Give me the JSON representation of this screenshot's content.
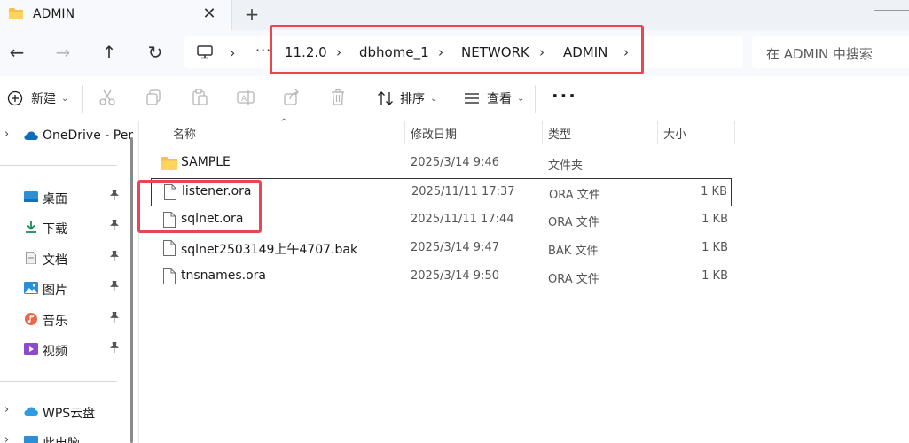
{
  "window": {
    "tab_title": "ADMIN",
    "new_tab": "+",
    "close": "✕"
  },
  "nav": {
    "back": "←",
    "forward": "→",
    "up": "↑",
    "refresh": "↻"
  },
  "address": {
    "more": "···",
    "chevron": "›",
    "crumbs": [
      "11.2.0",
      "dbhome_1",
      "NETWORK",
      "ADMIN"
    ],
    "separator": "›"
  },
  "search": {
    "placeholder": "在 ADMIN 中搜索"
  },
  "toolbar": {
    "new_label": "新建",
    "sort_label": "排序",
    "view_label": "查看",
    "more": "···",
    "dropdown": "⌄"
  },
  "sidebar": {
    "items": [
      {
        "label": "OneDrive - Per",
        "icon": "cloud-icon"
      },
      {
        "label": "桌面",
        "icon": "desktop-icon",
        "pinned": true
      },
      {
        "label": "下载",
        "icon": "download-icon",
        "pinned": true
      },
      {
        "label": "文档",
        "icon": "document-icon",
        "pinned": true
      },
      {
        "label": "图片",
        "icon": "pictures-icon",
        "pinned": true
      },
      {
        "label": "音乐",
        "icon": "music-icon",
        "pinned": true
      },
      {
        "label": "视频",
        "icon": "video-icon",
        "pinned": true
      },
      {
        "label": "WPS云盘",
        "icon": "wps-cloud-icon"
      },
      {
        "label": "此电脑",
        "icon": "computer-icon"
      }
    ],
    "expander": "›",
    "pin": "📌"
  },
  "columns": {
    "name": "名称",
    "modified": "修改日期",
    "type": "类型",
    "size": "大小",
    "sort_arrow": "^"
  },
  "files": [
    {
      "name": "SAMPLE",
      "modified": "2025/3/14 9:46",
      "type": "文件夹",
      "size": "",
      "kind": "folder"
    },
    {
      "name": "listener.ora",
      "modified": "2025/11/11 17:37",
      "type": "ORA 文件",
      "size": "1 KB",
      "kind": "file",
      "selected": true
    },
    {
      "name": "sqlnet.ora",
      "modified": "2025/11/11 17:44",
      "type": "ORA 文件",
      "size": "1 KB",
      "kind": "file"
    },
    {
      "name": "sqlnet2503149上午4707.bak",
      "modified": "2025/3/14 9:47",
      "type": "BAK 文件",
      "size": "1 KB",
      "kind": "file"
    },
    {
      "name": "tnsnames.ora",
      "modified": "2025/3/14 9:50",
      "type": "ORA 文件",
      "size": "1 KB",
      "kind": "file"
    }
  ],
  "colors": {
    "highlight": "#e8474f",
    "folder": "#f5c043",
    "accent": "#0067c0"
  }
}
